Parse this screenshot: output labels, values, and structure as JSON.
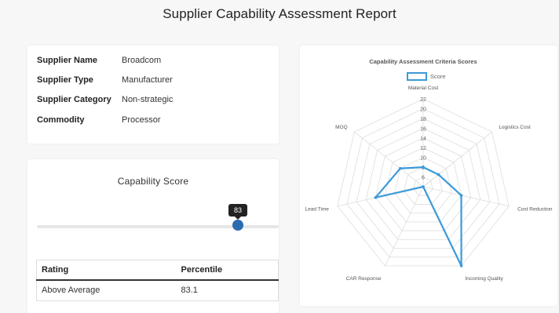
{
  "page": {
    "title": "Supplier Capability Assessment Report"
  },
  "supplier_info": [
    {
      "label": "Supplier Name",
      "value": "Broadcom"
    },
    {
      "label": "Supplier Type",
      "value": "Manufacturer"
    },
    {
      "label": "Supplier Category",
      "value": "Non-strategic"
    },
    {
      "label": "Commodity",
      "value": "Processor"
    }
  ],
  "capability": {
    "title": "Capability Score",
    "score": 83,
    "score_label": "83",
    "table": {
      "headers": [
        "Rating",
        "Percentile"
      ],
      "rows": [
        [
          "Above Average",
          "83.1"
        ]
      ]
    }
  },
  "colors": {
    "accent": "#2b6cb0",
    "series": "#3b9ad9"
  },
  "chart_data": {
    "type": "radar",
    "title": "Capability Assessment Criteria Scores",
    "legend": "top",
    "categories": [
      "Material Cost",
      "Logistics Cost",
      "Cost Reduction",
      "Incoming Quality",
      "CAR Response",
      "Lead Time",
      "MOQ"
    ],
    "series": [
      {
        "name": "Score",
        "values": [
          8,
          8,
          12,
          22,
          4,
          14,
          10
        ]
      }
    ],
    "r_ticks": [
      6,
      8,
      10,
      12,
      14,
      16,
      18,
      20,
      22
    ],
    "r_range": [
      4,
      22
    ],
    "grid": true
  }
}
